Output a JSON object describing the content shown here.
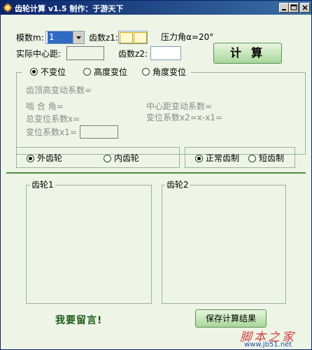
{
  "window": {
    "title": "齿轮计算 v1.5  制作：于游天下"
  },
  "inputs": {
    "module_label": "模数m:",
    "module_value": "1",
    "z1_label": "齿数z1:",
    "z1_value": "",
    "pressure_angle_label": "压力角α=20°",
    "center_distance_label": "实际中心距:",
    "center_distance_value": "",
    "z2_label": "齿数z2:",
    "z2_value": ""
  },
  "calc_button": "计算",
  "shift_mode": {
    "options": [
      "不变位",
      "高度变位",
      "角度变位"
    ],
    "selected": 0,
    "fields": {
      "addendum_shift": "齿顶高变动系数=",
      "mesh_angle": "啮  合  角=",
      "center_shift": "中心距变动系数=",
      "total_shift": "总变位系数x=",
      "shift_x2": "变位系数x2=x-x1=",
      "shift_x1": "变位系数x1="
    },
    "shift_x1_value": ""
  },
  "gear_type": {
    "options": [
      "外齿轮",
      "内齿轮"
    ],
    "selected": 0
  },
  "tooth_system": {
    "options": [
      "正常齿制",
      "短齿制"
    ],
    "selected": 0
  },
  "results": {
    "gear1_label": "齿轮1",
    "gear2_label": "齿轮2"
  },
  "footer": {
    "message_link": "我要留言!",
    "save_button": "保存计算结果"
  },
  "watermark": {
    "main": "脚本之家",
    "sub": "www.jb51.net"
  }
}
